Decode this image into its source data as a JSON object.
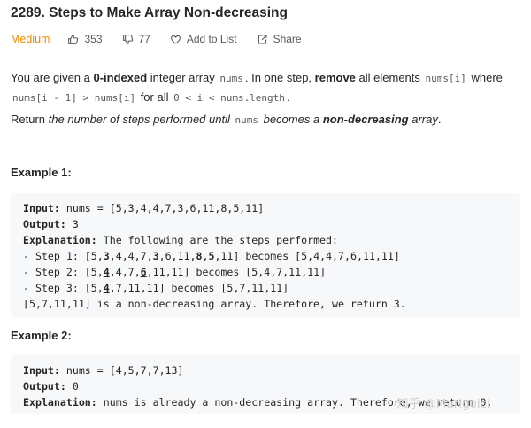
{
  "problem": {
    "title": "2289. Steps to Make Array Non-decreasing",
    "difficulty": "Medium",
    "likes": "353",
    "dislikes": "77",
    "add_to_list": "Add to List",
    "share": "Share",
    "colors": {
      "difficulty": "#ef8b00"
    }
  },
  "description": {
    "p1": {
      "t1": "You are given a ",
      "b1": "0-indexed",
      "t2": " integer array ",
      "c1": "nums",
      "t3": ". In one step, ",
      "b2": "remove",
      "t4": " all elements ",
      "c2": "nums[i]",
      "t5": " where ",
      "c3": "nums[i - 1] > nums[i]",
      "t6": " for all ",
      "c4": "0 < i < nums.length",
      "t7": "."
    },
    "p2": {
      "t1": "Return ",
      "i1": "the number of steps performed until ",
      "c1": "nums",
      "i2": " becomes a ",
      "b1": "non-decreasing",
      "i3": " array",
      "t2": "."
    }
  },
  "example1": {
    "heading": "Example 1:",
    "input_label": "Input:",
    "input_value": " nums = [5,3,4,4,7,3,6,11,8,5,11]",
    "output_label": "Output:",
    "output_value": " 3",
    "explanation_label": "Explanation:",
    "explanation_value": " The following are the steps performed:",
    "step1": {
      "a": "- Step 1: [5,",
      "u1": "3",
      "b": ",4,4,7,",
      "u2": "3",
      "c": ",6,11,",
      "u3": "8",
      "d": ",",
      "u4": "5",
      "e": ",11] becomes [5,4,4,7,6,11,11]"
    },
    "step2": {
      "a": "- Step 2: [5,",
      "u1": "4",
      "b": ",4,7,",
      "u2": "6",
      "c": ",11,11] becomes [5,4,7,11,11]"
    },
    "step3": {
      "a": "- Step 3: [5,",
      "u1": "4",
      "b": ",7,11,11] becomes [5,7,11,11]"
    },
    "conclusion": "[5,7,11,11] is a non-decreasing array. Therefore, we return 3."
  },
  "example2": {
    "heading": "Example 2:",
    "input_label": "Input:",
    "input_value": " nums = [4,5,7,7,13]",
    "output_label": "Output:",
    "output_value": " 0",
    "explanation_label": "Explanation:",
    "explanation_value": " nums is already a non-decreasing array. Therefore, we return 0."
  },
  "watermark": "知乎 @Marigolci"
}
